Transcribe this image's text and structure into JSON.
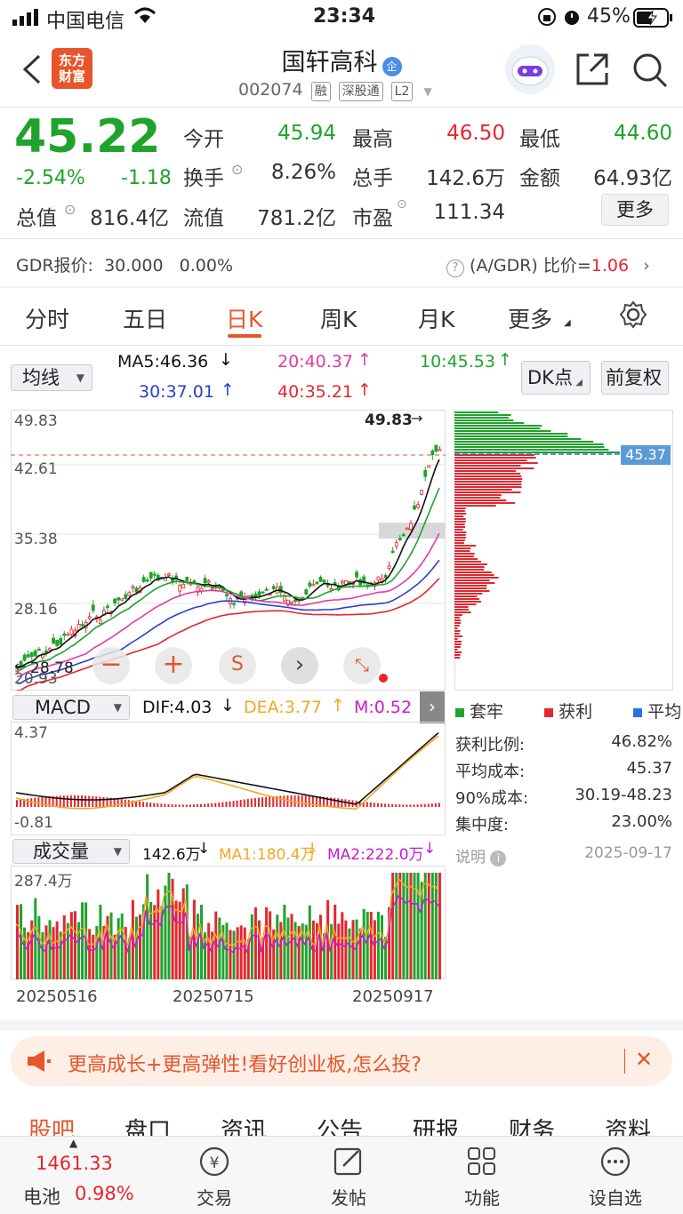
{
  "status_bar": {
    "carrier": "中国电信",
    "time": "23:34",
    "battery": "45%"
  },
  "header": {
    "logo": [
      "东方",
      "财富"
    ],
    "name": "国轩高科",
    "badge": "企",
    "code": "002074",
    "tags": [
      "融",
      "深股通",
      "L2"
    ]
  },
  "quote": {
    "price": "45.22",
    "change_pct": "-2.54%",
    "change": "-1.18",
    "rows": [
      [
        {
          "label": "今开",
          "value": "45.94",
          "color": "green"
        },
        {
          "label": "最高",
          "value": "46.50",
          "color": "red"
        },
        {
          "label": "最低",
          "value": "44.60",
          "color": "green"
        }
      ],
      [
        {
          "label": "换手",
          "value": "8.26%",
          "color": "dark"
        },
        {
          "label": "总手",
          "value": "142.6万",
          "color": "dark"
        },
        {
          "label": "金额",
          "value": "64.93亿",
          "color": "dark"
        }
      ],
      [
        {
          "label": "流值",
          "value": "781.2亿",
          "color": "dark"
        },
        {
          "label": "市盈",
          "value": "111.34",
          "color": "dark"
        }
      ]
    ],
    "total_label": "总值",
    "total_value": "816.4亿",
    "more_button": "更多"
  },
  "gdr": {
    "label": "GDR报价:",
    "price": "30.000",
    "pct": "0.00%",
    "ratio_label": "(A/GDR) 比价=",
    "ratio_value": "1.06"
  },
  "tabs": [
    "分时",
    "五日",
    "日K",
    "周K",
    "月K",
    "更多"
  ],
  "active_tab": "日K",
  "ma_bar": {
    "dropdown": "均线",
    "ma5": "MA5:46.36",
    "ma20": "20:40.37",
    "ma10": "10:45.53",
    "ma30": "30:37.01",
    "ma40": "40:35.21",
    "dk_button": "DK点",
    "fq_button": "前复权"
  },
  "kline": {
    "y_labels": [
      "49.83",
      "42.61",
      "35.38",
      "28.16",
      "20.93"
    ],
    "high_marker": "49.83",
    "low_marker": "28.78",
    "current_tag": "45.37"
  },
  "chip": {
    "legend": [
      "套牢",
      "获利",
      "平均"
    ],
    "stats": [
      {
        "label": "获利比例:",
        "value": "46.82%"
      },
      {
        "label": "平均成本:",
        "value": "45.37"
      },
      {
        "label": "90%成本:",
        "value": "30.19-48.23"
      },
      {
        "label": "集中度:",
        "value": "23.00%"
      }
    ],
    "note_label": "说明",
    "date": "2025-09-17"
  },
  "macd": {
    "dropdown": "MACD",
    "dif": "DIF:4.03",
    "dea": "DEA:3.77",
    "m": "M:0.52",
    "y_top": "4.37",
    "y_bottom": "-0.81"
  },
  "volume": {
    "dropdown": "成交量",
    "vol": "142.6万",
    "ma1": "MA1:180.4万",
    "ma2": "MA2:222.0万",
    "y_top": "287.4万"
  },
  "dates": [
    "20250516",
    "20250715",
    "20250917"
  ],
  "banner": {
    "text": "更高成长+更高弹性!看好创业板,怎么投?"
  },
  "bottom_tabs": [
    "股吧",
    "盘口",
    "资讯",
    "公告",
    "研报",
    "财务",
    "资料"
  ],
  "bottom_nav": {
    "index_value": "1461.33",
    "index_name": "电池",
    "index_pct": "0.98%",
    "items": [
      "交易",
      "发帖",
      "功能",
      "设自选"
    ]
  }
}
